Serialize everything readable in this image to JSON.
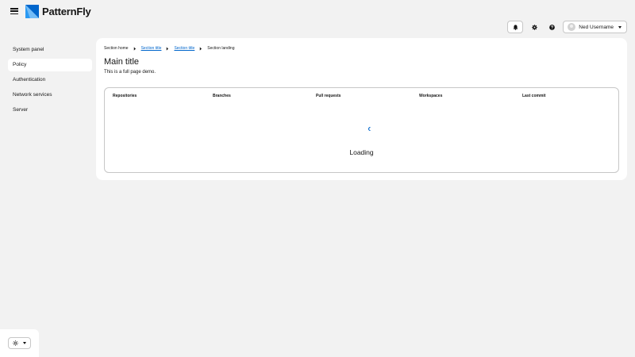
{
  "masthead": {
    "brand": "PatternFly",
    "user_name": "Ned Username"
  },
  "sidebar": {
    "items": [
      {
        "label": "System panel"
      },
      {
        "label": "Policy",
        "active": true
      },
      {
        "label": "Authentication"
      },
      {
        "label": "Network services"
      },
      {
        "label": "Server"
      }
    ]
  },
  "breadcrumb": [
    {
      "label": "Section home",
      "link": false
    },
    {
      "label": "Section title",
      "link": true
    },
    {
      "label": "Section title",
      "link": true
    },
    {
      "label": "Section landing",
      "link": false
    }
  ],
  "page": {
    "title": "Main title",
    "description": "This is a full page demo."
  },
  "table": {
    "columns": [
      "Repositories",
      "Branches",
      "Pull requests",
      "Workspaces",
      "Last commit"
    ],
    "loading_text": "Loading"
  },
  "colors": {
    "accent": "#0066cc",
    "brand_light": "#73bcf7",
    "brand_dark": "#0066cc"
  },
  "icons": {
    "menu": "hamburger-icon",
    "notifications": "bell-icon",
    "settings": "gear-icon",
    "help": "question-circle-icon",
    "theme": "sun-icon"
  }
}
